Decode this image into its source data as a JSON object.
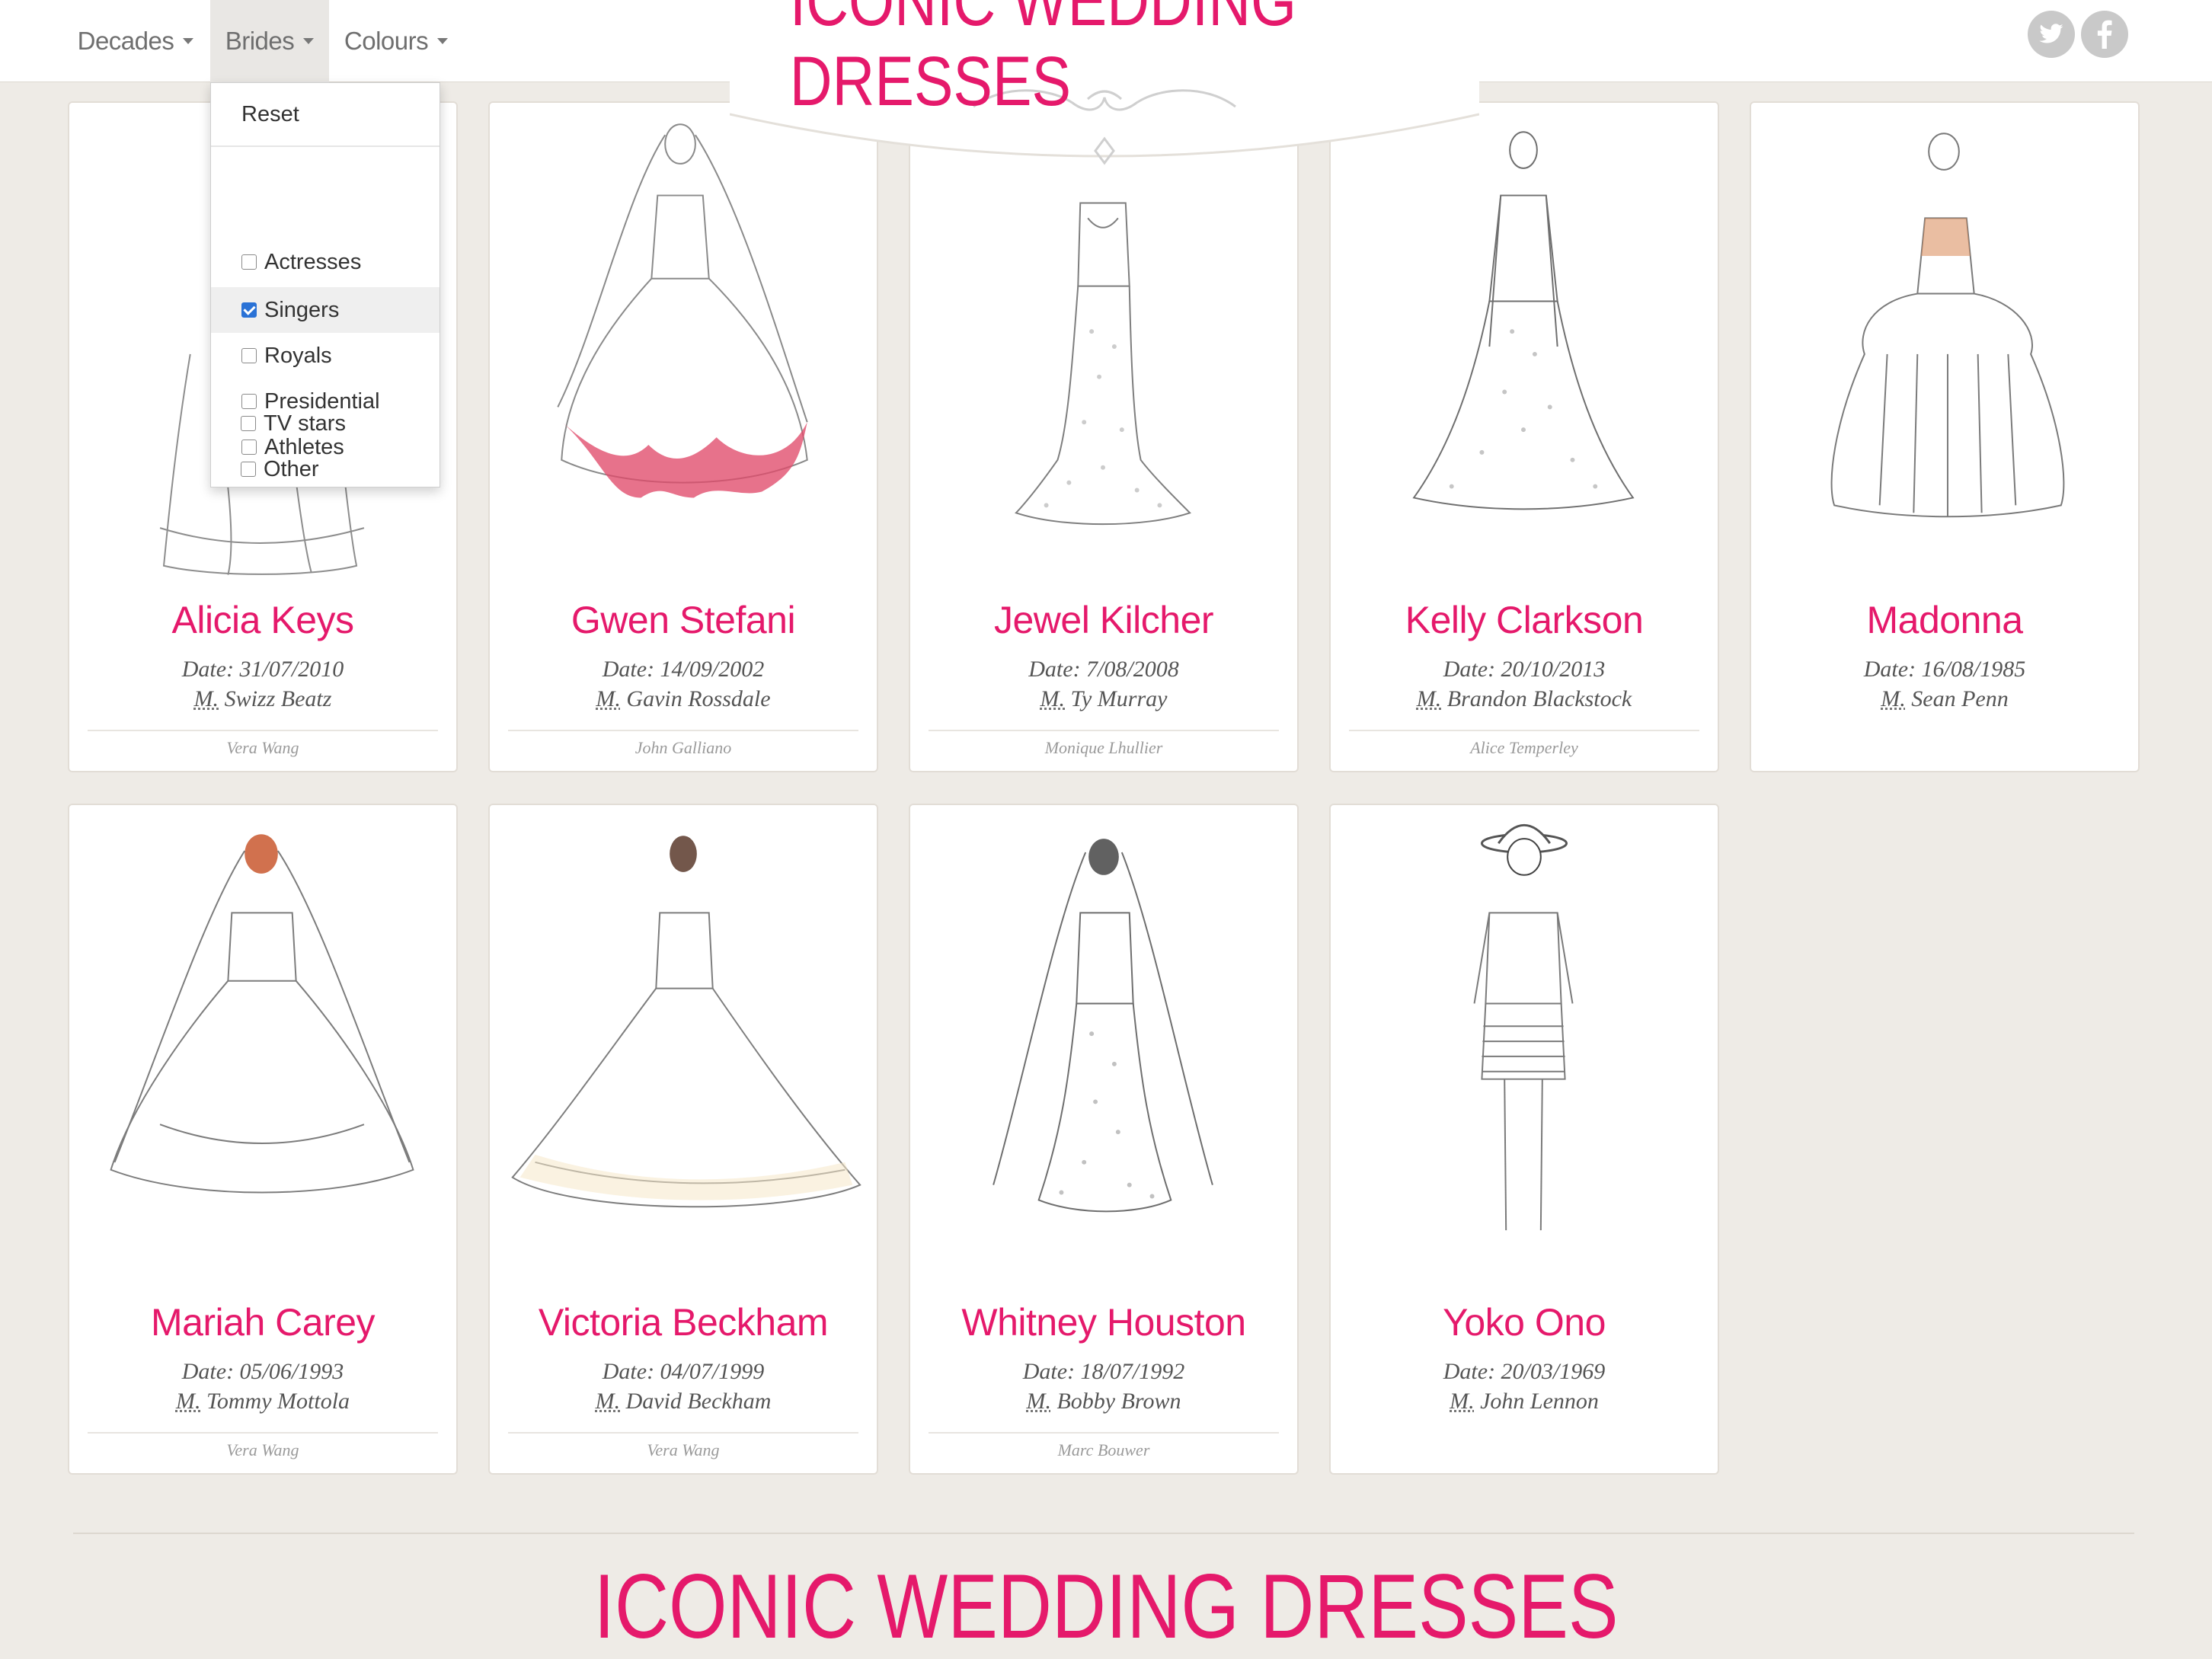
{
  "nav": {
    "decades_label": "Decades",
    "brides_label": "Brides",
    "colours_label": "Colours"
  },
  "banner": {
    "title": "ICONIC WEDDING DRESSES"
  },
  "social": {
    "twitter": "twitter-icon",
    "facebook": "facebook-icon"
  },
  "dropdown": {
    "reset_label": "Reset",
    "options": [
      {
        "label": "Actresses",
        "checked": false
      },
      {
        "label": "Singers",
        "checked": true
      },
      {
        "label": "Royals",
        "checked": false
      },
      {
        "label": "Presidential",
        "checked": false
      },
      {
        "label": "Athletes",
        "checked": false
      },
      {
        "label": "TV stars",
        "checked": false
      },
      {
        "label": "Other",
        "checked": false
      }
    ]
  },
  "cards": [
    {
      "name": "Alicia Keys",
      "date": "Date: 31/07/2010",
      "married_prefix": "M.",
      "spouse": " Swizz Beatz",
      "designer": "Vera Wang"
    },
    {
      "name": "Gwen Stefani",
      "date": "Date: 14/09/2002",
      "married_prefix": "M.",
      "spouse": " Gavin Rossdale",
      "designer": "John Galliano"
    },
    {
      "name": "Jewel Kilcher",
      "date": "Date: 7/08/2008",
      "married_prefix": "M.",
      "spouse": " Ty Murray",
      "designer": "Monique Lhullier"
    },
    {
      "name": "Kelly Clarkson",
      "date": "Date: 20/10/2013",
      "married_prefix": "M.",
      "spouse": " Brandon Blackstock",
      "designer": "Alice Temperley"
    },
    {
      "name": "Madonna",
      "date": "Date: 16/08/1985",
      "married_prefix": "M.",
      "spouse": " Sean Penn",
      "designer": ""
    },
    {
      "name": "Mariah Carey",
      "date": "Date: 05/06/1993",
      "married_prefix": "M.",
      "spouse": " Tommy Mottola",
      "designer": "Vera Wang"
    },
    {
      "name": "Victoria Beckham",
      "date": "Date: 04/07/1999",
      "married_prefix": "M.",
      "spouse": " David Beckham",
      "designer": "Vera Wang"
    },
    {
      "name": "Whitney Houston",
      "date": "Date: 18/07/1992",
      "married_prefix": "M.",
      "spouse": " Bobby Brown",
      "designer": "Marc Bouwer"
    },
    {
      "name": "Yoko Ono",
      "date": "Date: 20/03/1969",
      "married_prefix": "M.",
      "spouse": " John Lennon",
      "designer": ""
    }
  ],
  "footer": {
    "title": "ICONIC WEDDING DRESSES"
  },
  "colors": {
    "accent": "#e5196b",
    "background": "#eeebe6",
    "checkbox": "#2a72d6"
  }
}
